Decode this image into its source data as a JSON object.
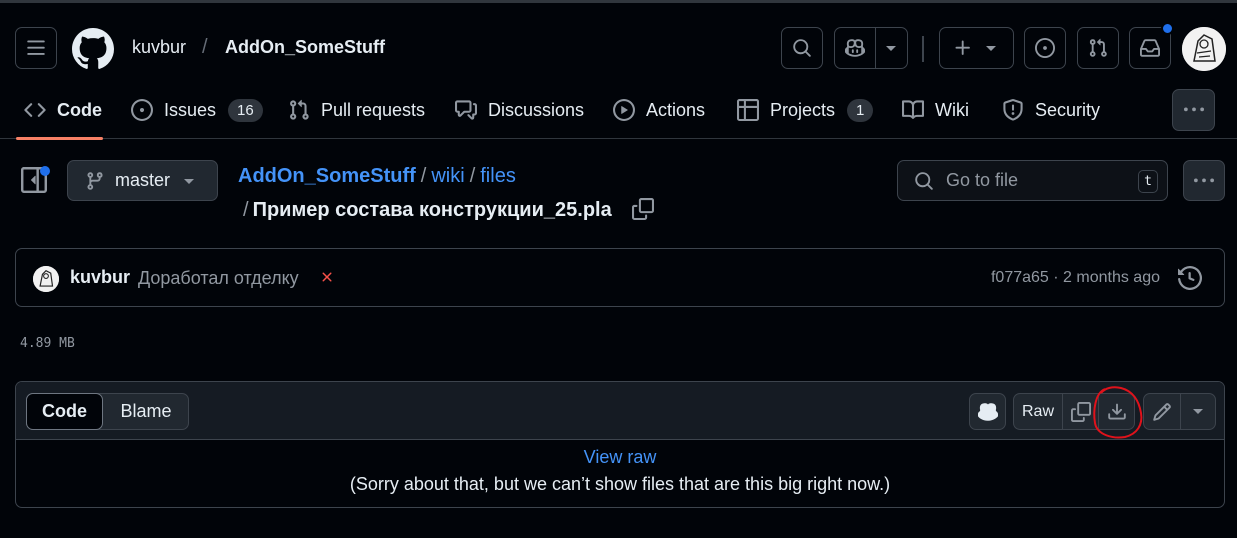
{
  "header": {
    "owner": "kuvbur",
    "separator": "/",
    "repo": "AddOn_SomeStuff",
    "icons": [
      "menu-icon",
      "github-logo",
      "search-icon",
      "copilot-icon",
      "plus-icon",
      "issues-icon",
      "pull-request-icon",
      "inbox-icon"
    ]
  },
  "tabs": [
    {
      "label": "Code",
      "icon": "code-icon",
      "active": true
    },
    {
      "label": "Issues",
      "icon": "issue-icon",
      "count": "16"
    },
    {
      "label": "Pull requests",
      "icon": "pull-request-icon"
    },
    {
      "label": "Discussions",
      "icon": "discussions-icon"
    },
    {
      "label": "Actions",
      "icon": "play-icon"
    },
    {
      "label": "Projects",
      "icon": "table-icon",
      "count": "1"
    },
    {
      "label": "Wiki",
      "icon": "book-icon"
    },
    {
      "label": "Security",
      "icon": "shield-icon"
    }
  ],
  "filebar": {
    "branch": "master",
    "path": [
      "AddOn_SomeStuff",
      "wiki",
      "files"
    ],
    "separator": "/",
    "filename": "Пример состава конструкции_25.pla",
    "goto_placeholder": "Go to file",
    "goto_shortcut": "t"
  },
  "commit": {
    "author": "kuvbur",
    "message": "Доработал отделку",
    "meta": "f077a65 · 2 months ago",
    "status": "failed"
  },
  "file_size": "4.89 MB",
  "fileview": {
    "tab_code": "Code",
    "tab_blame": "Blame",
    "raw_label": "Raw",
    "view_raw": "View raw",
    "message": "(Sorry about that, but we can’t show files that are this big right now.)"
  },
  "colors": {
    "background": "#010409",
    "link": "#4493f8",
    "accent_underline": "#f78166",
    "error": "#f85149",
    "notification": "#1f6feb",
    "annotation": "#e0121b"
  }
}
